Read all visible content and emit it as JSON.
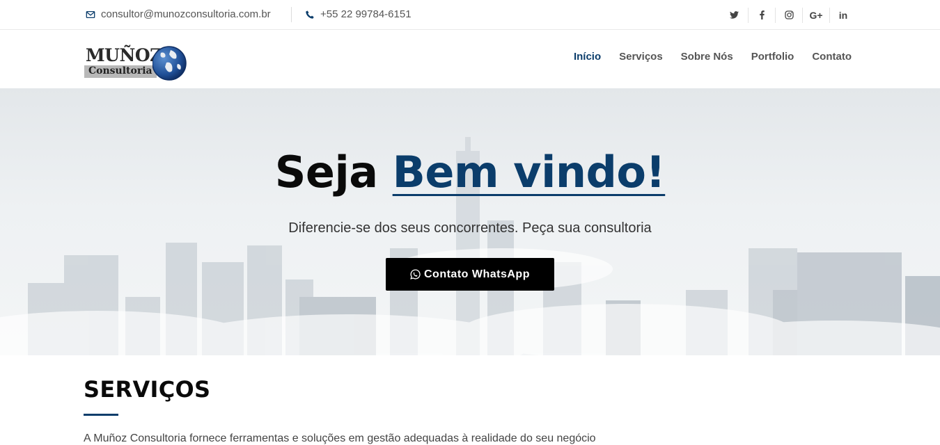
{
  "topbar": {
    "email": "consultor@munozconsultoria.com.br",
    "phone": "+55 22 99784-6151",
    "socials": [
      {
        "name": "twitter-icon",
        "glyph": "🐦︎"
      },
      {
        "name": "facebook-icon",
        "glyph": "f"
      },
      {
        "name": "instagram-icon",
        "glyph": "◎"
      },
      {
        "name": "google-plus-icon",
        "glyph": "G+"
      },
      {
        "name": "linkedin-icon",
        "glyph": "in"
      }
    ]
  },
  "logo": {
    "line1": "MUÑOZ",
    "line2": "Consultoria"
  },
  "nav": {
    "items": [
      {
        "label": "Início",
        "active": true
      },
      {
        "label": "Serviços",
        "active": false
      },
      {
        "label": "Sobre Nós",
        "active": false
      },
      {
        "label": "Portfolio",
        "active": false
      },
      {
        "label": "Contato",
        "active": false
      }
    ]
  },
  "hero": {
    "title_plain": "Seja",
    "title_accent": "Bem vindo!",
    "subtitle": "Diferencie-se dos seus concorrentes. Peça sua consultoria",
    "button_label": "Contato WhatsApp"
  },
  "services": {
    "title": "SERVIÇOS",
    "text": "A Muñoz Consultoria fornece ferramentas e soluções em gestão adequadas à realidade do seu negócio"
  },
  "colors": {
    "accent": "#0b3d6b",
    "button_bg": "#000000",
    "text": "#555555"
  }
}
